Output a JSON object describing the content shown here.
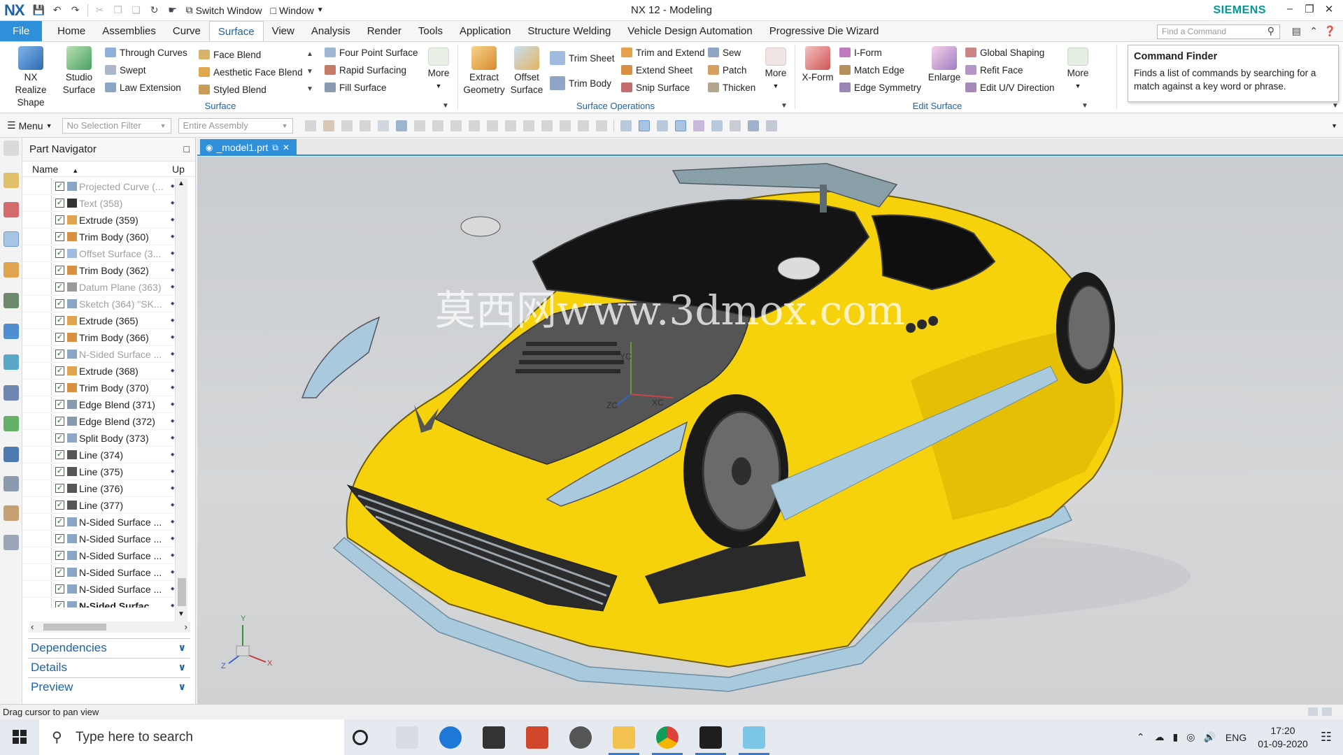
{
  "app": {
    "logo": "NX",
    "window_title": "NX 12 - Modeling",
    "brand": "SIEMENS",
    "switch_window_label": "Switch Window",
    "window_menu_label": "Window"
  },
  "tabs": [
    "File",
    "Home",
    "Assemblies",
    "Curve",
    "Surface",
    "View",
    "Analysis",
    "Render",
    "Tools",
    "Application",
    "Structure Welding",
    "Vehicle Design Automation",
    "Progressive Die Wizard"
  ],
  "active_tab": "Surface",
  "find_command_placeholder": "Find a Command",
  "ribbon": {
    "nx_realize_shape": "NX Realize Shape",
    "studio_surface": "Studio Surface",
    "through_curves": "Through Curves",
    "swept": "Swept",
    "law_extension": "Law Extension",
    "face_blend": "Face Blend",
    "aesthetic_face_blend": "Aesthetic Face Blend",
    "styled_blend": "Styled Blend",
    "four_point_surface": "Four Point Surface",
    "rapid_surfacing": "Rapid Surfacing",
    "fill_surface": "Fill Surface",
    "more_1": "More",
    "group_surface": "Surface",
    "extract_geometry": "Extract Geometry",
    "offset_surface": "Offset Surface",
    "trim_sheet": "Trim Sheet",
    "trim_body": "Trim Body",
    "trim_and_extend": "Trim and Extend",
    "extend_sheet": "Extend Sheet",
    "snip_surface": "Snip Surface",
    "sew": "Sew",
    "patch": "Patch",
    "thicken": "Thicken",
    "more_2": "More",
    "group_surface_operations": "Surface Operations",
    "x_form": "X-Form",
    "i_form": "I-Form",
    "match_edge": "Match Edge",
    "edge_symmetry": "Edge Symmetry",
    "enlarge": "Enlarge",
    "global_shaping": "Global Shaping",
    "refit_face": "Refit Face",
    "edit_uv_direction": "Edit U/V Direction",
    "more_3": "More",
    "group_edit_surface": "Edit Surface"
  },
  "command_finder": {
    "title": "Command Finder",
    "text": "Finds a list of commands by searching for a match against a key word or phrase."
  },
  "selection_bar": {
    "menu_label": "Menu",
    "selection_filter": "No Selection Filter",
    "scope": "Entire Assembly"
  },
  "part_navigator": {
    "title": "Part Navigator",
    "col_name": "Name",
    "col_up": "Up",
    "rows": [
      {
        "label": "Projected Curve (...",
        "dim": true,
        "bold": false
      },
      {
        "label": "Text (358)",
        "dim": true,
        "bold": false
      },
      {
        "label": "Extrude (359)",
        "dim": false,
        "bold": false
      },
      {
        "label": "Trim Body (360)",
        "dim": false,
        "bold": false
      },
      {
        "label": "Offset Surface (3...",
        "dim": true,
        "bold": false
      },
      {
        "label": "Trim Body (362)",
        "dim": false,
        "bold": false
      },
      {
        "label": "Datum Plane (363)",
        "dim": true,
        "bold": false
      },
      {
        "label": "Sketch (364) \"SK...",
        "dim": true,
        "bold": false
      },
      {
        "label": "Extrude (365)",
        "dim": false,
        "bold": false
      },
      {
        "label": "Trim Body (366)",
        "dim": false,
        "bold": false
      },
      {
        "label": "N-Sided Surface ...",
        "dim": true,
        "bold": false
      },
      {
        "label": "Extrude (368)",
        "dim": false,
        "bold": false
      },
      {
        "label": "Trim Body (370)",
        "dim": false,
        "bold": false
      },
      {
        "label": "Edge Blend (371)",
        "dim": false,
        "bold": false
      },
      {
        "label": "Edge Blend (372)",
        "dim": false,
        "bold": false
      },
      {
        "label": "Split Body (373)",
        "dim": false,
        "bold": false
      },
      {
        "label": "Line (374)",
        "dim": false,
        "bold": false
      },
      {
        "label": "Line (375)",
        "dim": false,
        "bold": false
      },
      {
        "label": "Line (376)",
        "dim": false,
        "bold": false
      },
      {
        "label": "Line (377)",
        "dim": false,
        "bold": false
      },
      {
        "label": "N-Sided Surface ...",
        "dim": false,
        "bold": false
      },
      {
        "label": "N-Sided Surface ...",
        "dim": false,
        "bold": false
      },
      {
        "label": "N-Sided Surface ...",
        "dim": false,
        "bold": false
      },
      {
        "label": "N-Sided Surface ...",
        "dim": false,
        "bold": false
      },
      {
        "label": "N-Sided Surface ...",
        "dim": false,
        "bold": false
      },
      {
        "label": "N-Sided Surfac...",
        "dim": false,
        "bold": true
      }
    ],
    "panels": [
      "Dependencies",
      "Details",
      "Preview"
    ]
  },
  "graphics": {
    "tab_label": "_model1.prt",
    "watermark": "莫西网www.3dmox.com",
    "csys_labels": [
      "YC",
      "ZC",
      "XC"
    ],
    "triad_labels": [
      "Y",
      "Z",
      "X"
    ]
  },
  "status_text": "Drag cursor to pan view",
  "taskbar": {
    "search_placeholder": "Type here to search",
    "language": "ENG",
    "time": "17:20",
    "date": "01-09-2020"
  },
  "colors": {
    "accent": "#2f8fd8",
    "brand": "#009999",
    "car_body": "#f5d20c"
  }
}
